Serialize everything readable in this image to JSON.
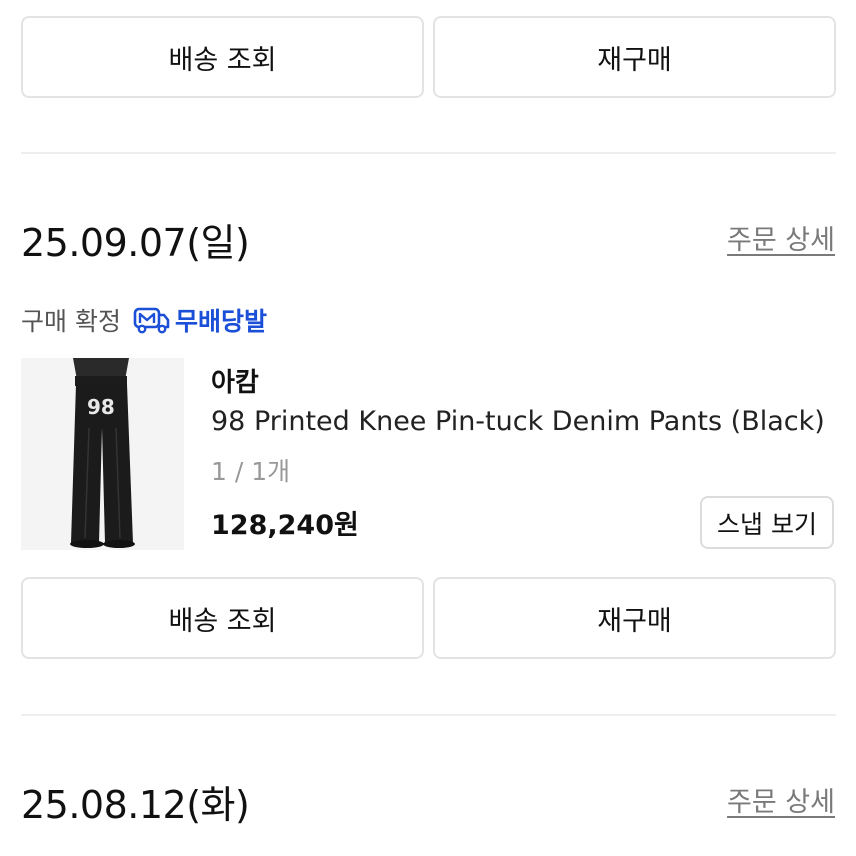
{
  "top_actions": {
    "track_label": "배송 조회",
    "rebuy_label": "재구매"
  },
  "orders": [
    {
      "date": "25.09.07(일)",
      "detail_label": "주문 상세",
      "status": "구매 확정",
      "shipping_badge": "무배당발",
      "item": {
        "brand": "아캄",
        "name": "98 Printed Knee Pin-tuck Denim Pants (Black)",
        "quantity": "1 / 1개",
        "price": "128,240원",
        "snap_label": "스냅 보기",
        "print_number": "98"
      },
      "actions": {
        "track_label": "배송 조회",
        "rebuy_label": "재구매"
      }
    },
    {
      "date": "25.08.12(화)",
      "detail_label": "주문 상세"
    }
  ],
  "colors": {
    "accent_blue": "#1c4fd8",
    "muted_text": "#7a7a7a",
    "border": "#e3e3e3"
  },
  "icons": {
    "shipping": "truck-m-icon"
  }
}
